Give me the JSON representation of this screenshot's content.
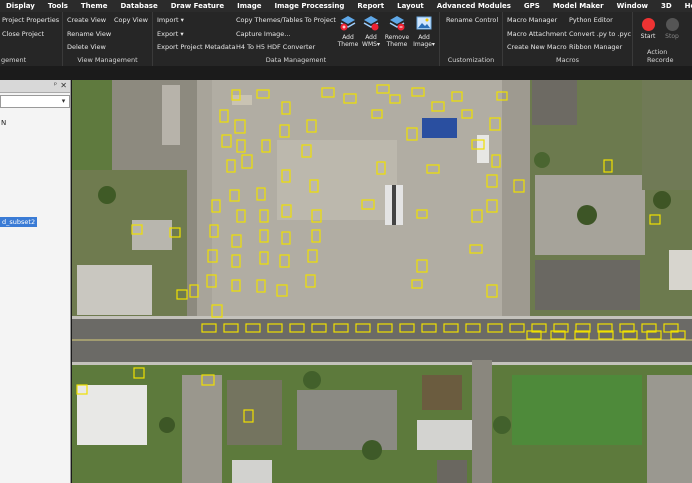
{
  "menu": [
    "Display",
    "Tools",
    "Theme",
    "Database",
    "Draw Feature",
    "Image",
    "Image Processing",
    "Report",
    "Layout",
    "Advanced Modules",
    "GPS",
    "Model Maker",
    "Window",
    "3D",
    "Help"
  ],
  "ribbon": {
    "project": {
      "items": [
        "Project Properties",
        "Close Project"
      ],
      "title": "gement"
    },
    "view": {
      "items": [
        "Create View",
        "Rename View",
        "Delete View",
        "Copy View"
      ],
      "title": "View Management"
    },
    "data": {
      "import": "Import ▾",
      "export": "Export ▾",
      "export_meta": "Export Project Metadata",
      "copy_themes": "Copy Themes/Tables To Project",
      "capture": "Capture Image...",
      "h4h5": "H4 To H5 HDF Converter",
      "add_theme": "Add Theme",
      "add_wms": "Add WMS▾",
      "remove_theme": "Remove Theme",
      "add_image": "Add Image▾",
      "title": "Data Management"
    },
    "custom": {
      "rename_control": "Rename Control",
      "title": "Customization"
    },
    "macros": {
      "items": [
        "Macro Manager",
        "Macro Attachment",
        "Create New Macro",
        "Python Editor",
        "Convert .py to .pyc",
        "Ribbon Manager"
      ],
      "title": "Macros"
    },
    "recorder": {
      "start": "Start",
      "stop": "Stop",
      "title": "Action Recorde"
    }
  },
  "panel": {
    "pin": "ᵖ",
    "close": "✕",
    "text": "N",
    "selected": "d_subset2"
  },
  "colors": {
    "accent": "#3a7bd5",
    "detect": "#f0e000"
  }
}
